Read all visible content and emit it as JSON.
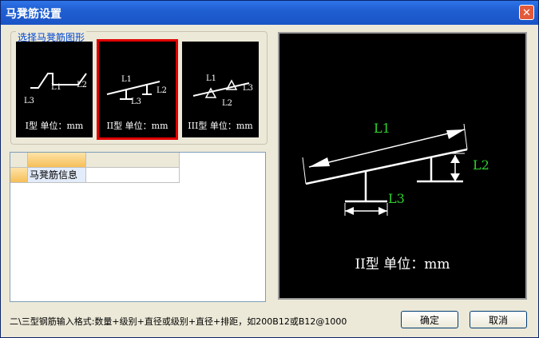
{
  "window": {
    "title": "马凳筋设置",
    "close_label": "✕"
  },
  "shape_group": {
    "label": "选择马凳筋图形",
    "selected": "II",
    "options": [
      {
        "id": "I",
        "caption": "I型 单位：mm",
        "labels": [
          "L1",
          "L2",
          "L3"
        ]
      },
      {
        "id": "II",
        "caption": "II型 单位：mm",
        "labels": [
          "L1",
          "L2",
          "L3"
        ]
      },
      {
        "id": "III",
        "caption": "III型 单位：mm",
        "labels": [
          "L1",
          "L3",
          "L2"
        ]
      }
    ]
  },
  "grid": {
    "row_label": "马凳筋信息",
    "value": ""
  },
  "preview": {
    "labels": {
      "l1": "L1",
      "l2": "L2",
      "l3": "L3"
    },
    "caption": "II型 单位：mm"
  },
  "footer": {
    "hint": "二\\三型钢筋输入格式:数量+级别+直径或级别+直径+排距，如200B12或B12@1000",
    "ok_label": "确定",
    "cancel_label": "取消"
  }
}
